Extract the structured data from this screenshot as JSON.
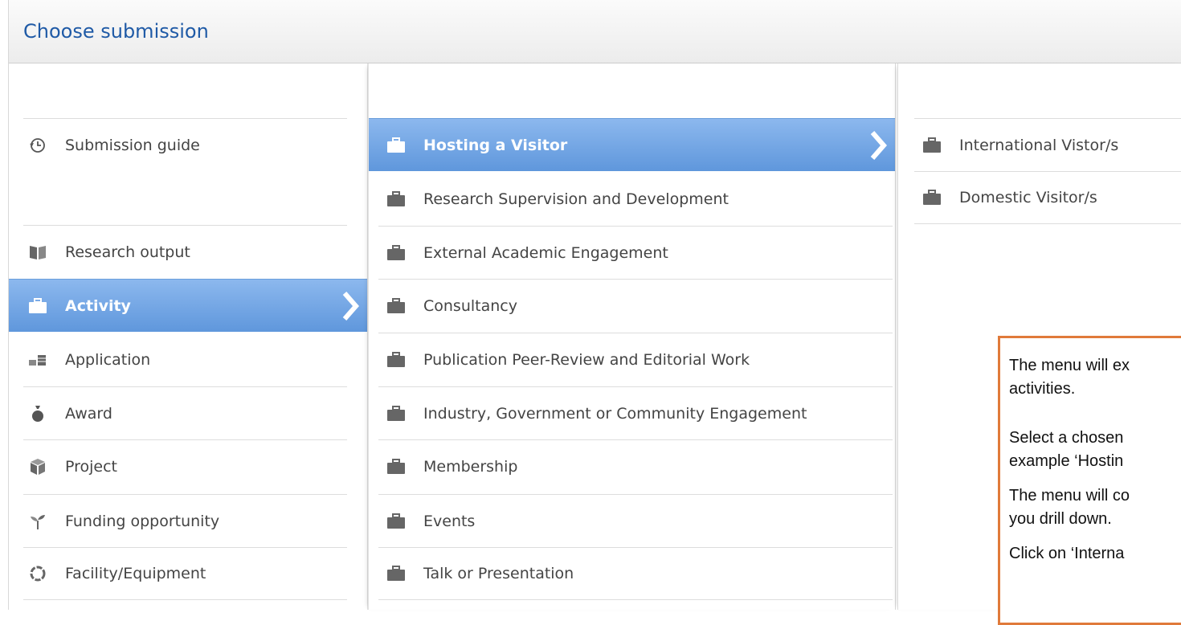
{
  "dialog": {
    "title": "Choose submission"
  },
  "column1": {
    "items": [
      {
        "label": "Submission guide",
        "icon": "clock-history-icon"
      },
      {
        "label": "Research output",
        "icon": "book-icon"
      },
      {
        "label": "Activity",
        "icon": "briefcase-icon",
        "selected": true
      },
      {
        "label": "Application",
        "icon": "coins-icon"
      },
      {
        "label": "Award",
        "icon": "money-bag-icon"
      },
      {
        "label": "Project",
        "icon": "cube-icon"
      },
      {
        "label": "Funding opportunity",
        "icon": "sprout-icon"
      },
      {
        "label": "Facility/Equipment",
        "icon": "ring-icon"
      }
    ]
  },
  "column2": {
    "items": [
      {
        "label": "Hosting a Visitor",
        "selected": true
      },
      {
        "label": "Research Supervision and Development"
      },
      {
        "label": "External Academic Engagement"
      },
      {
        "label": "Consultancy"
      },
      {
        "label": "Publication Peer-Review and Editorial Work"
      },
      {
        "label": "Industry, Government or Community Engagement"
      },
      {
        "label": "Membership"
      },
      {
        "label": "Events"
      },
      {
        "label": "Talk or Presentation"
      }
    ]
  },
  "column3": {
    "items": [
      {
        "label": "International Vistor/s"
      },
      {
        "label": "Domestic Visitor/s"
      }
    ]
  },
  "callout": {
    "line1": "The menu will ex",
    "line2": "activities.",
    "line3": "Select a chosen",
    "line4": "example ‘Hostin",
    "line5": "The menu will co",
    "line6": "you drill down.",
    "line7": "Click on ‘Interna"
  },
  "colors": {
    "accent_blue": "#5f97dc",
    "title_blue": "#1f5aa6",
    "callout_border": "#e07a3a"
  }
}
